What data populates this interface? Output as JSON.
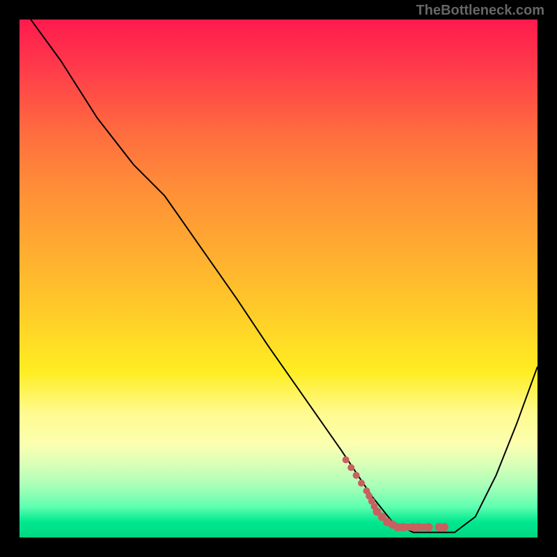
{
  "attribution": "TheBottleneck.com",
  "chart_data": {
    "type": "line",
    "title": "",
    "xlabel": "",
    "ylabel": "",
    "xlim": [
      0,
      100
    ],
    "ylim": [
      0,
      100
    ],
    "grid": false,
    "series": [
      {
        "name": "bottleneck-curve",
        "color": "#000000",
        "x": [
          0,
          8,
          15,
          22,
          28,
          35,
          42,
          48,
          55,
          62,
          68,
          72,
          76,
          80,
          84,
          88,
          92,
          96,
          100
        ],
        "y": [
          103,
          92,
          81,
          72,
          66,
          56,
          46,
          37,
          27,
          17,
          8,
          3,
          1,
          1,
          1,
          4,
          12,
          22,
          33
        ]
      },
      {
        "name": "optimal-region-marks",
        "color": "#c96060",
        "type": "scatter",
        "x": [
          63,
          64,
          65,
          66,
          67,
          67.5,
          68,
          68.5,
          69,
          70,
          71,
          72,
          73,
          74,
          76,
          77,
          79,
          81,
          82
        ],
        "y": [
          15,
          13.5,
          12,
          10.5,
          9,
          8,
          7,
          6,
          5,
          4,
          3,
          2.5,
          2,
          2,
          2,
          2,
          2,
          2,
          2
        ]
      }
    ]
  }
}
